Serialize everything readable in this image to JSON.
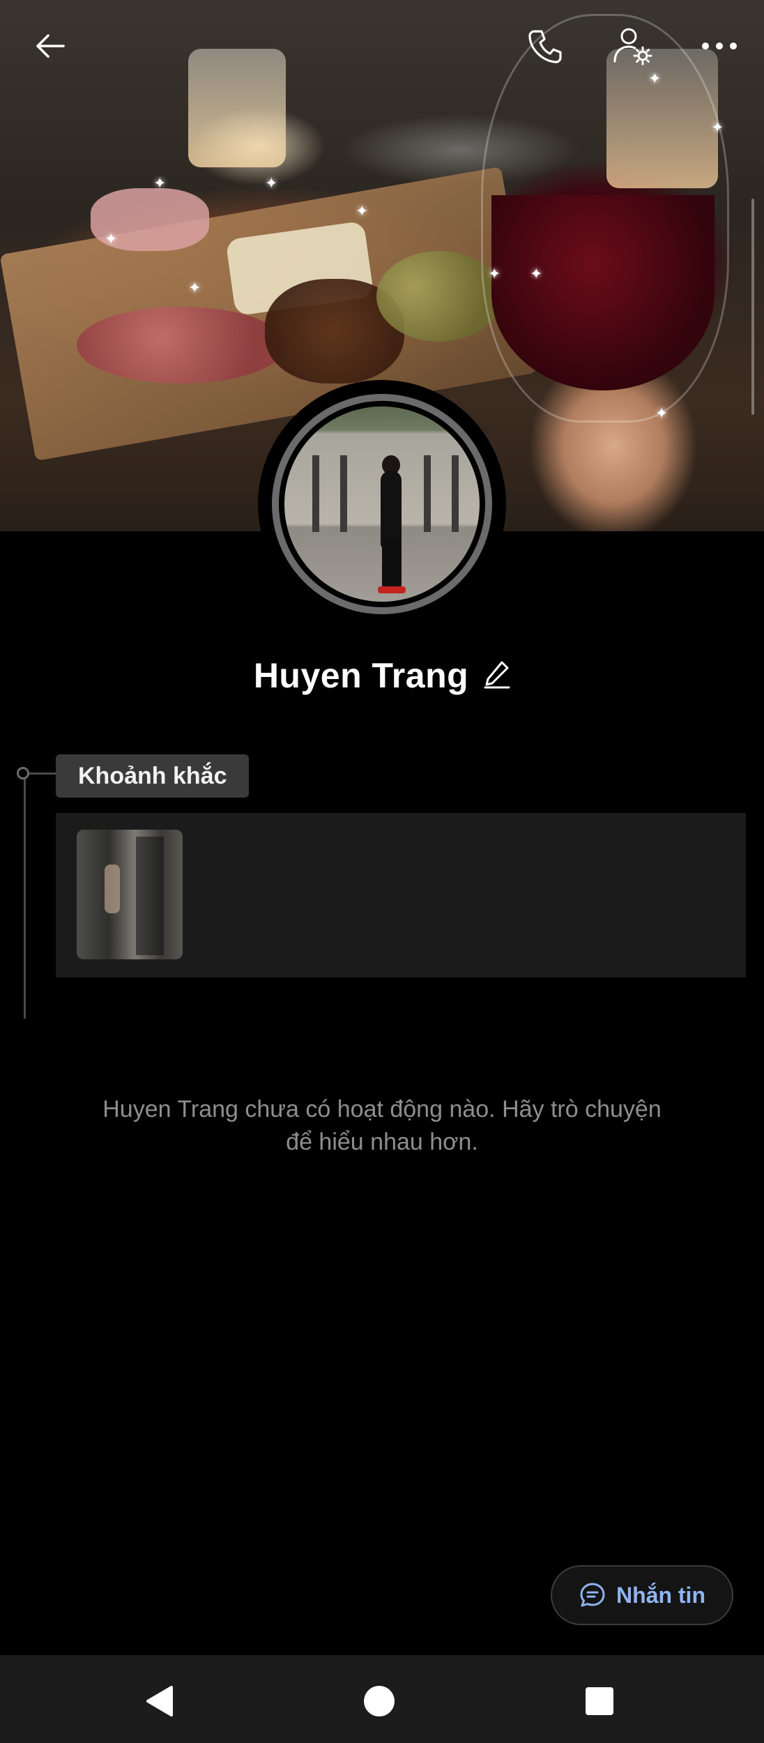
{
  "profile": {
    "name": "Huyen Trang"
  },
  "moments": {
    "label": "Khoảnh khắc",
    "items": [
      {
        "kind": "photo"
      }
    ]
  },
  "activity": {
    "empty_message": "Huyen Trang chưa có hoạt động nào. Hãy trò chuyện để hiểu nhau hơn."
  },
  "actions": {
    "message_label": "Nhắn tin"
  },
  "icons": {
    "back": "arrow-left-icon",
    "call": "phone-icon",
    "settings": "user-settings-icon",
    "more": "more-dots-icon",
    "edit": "pencil-icon",
    "chat": "chat-bubble-icon",
    "nav_back": "triangle-back-icon",
    "nav_home": "circle-home-icon",
    "nav_recent": "square-recent-icon"
  },
  "colors": {
    "background": "#000000",
    "card": "#1b1b1b",
    "label_bg": "#3a3a3a",
    "accent_link": "#8fb4f0",
    "muted_text": "#8e8e8e",
    "navbar": "#1c1c1c"
  }
}
